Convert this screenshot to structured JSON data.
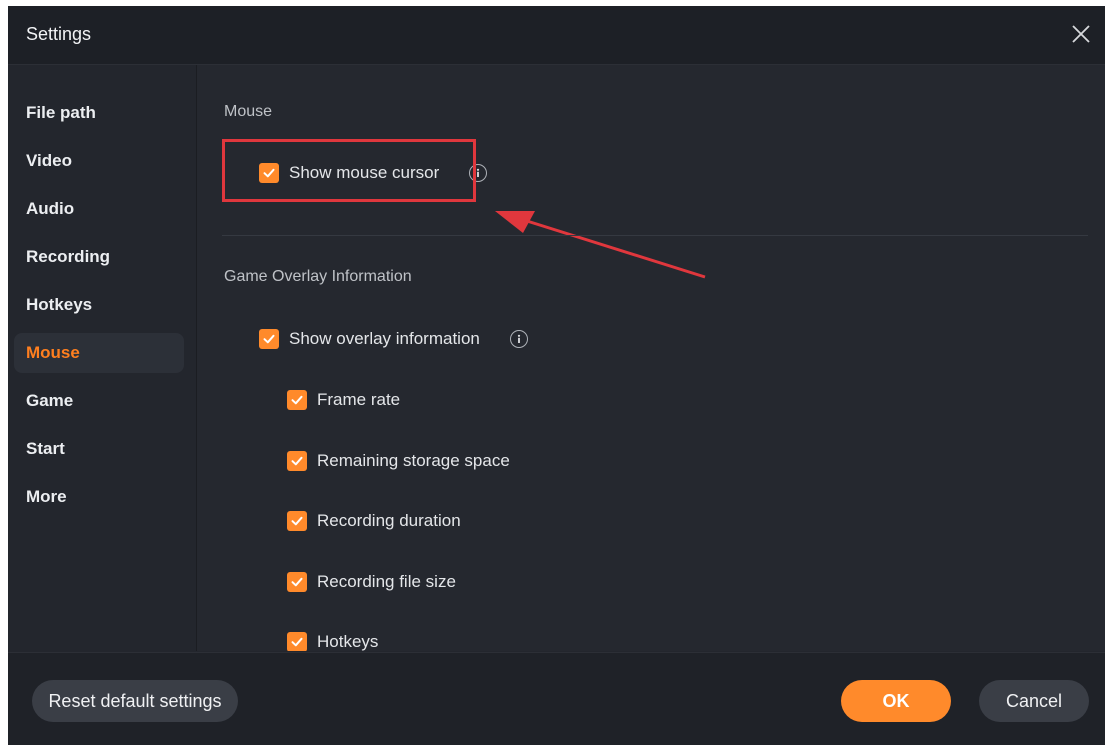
{
  "window": {
    "title": "Settings"
  },
  "sidebar": {
    "items": [
      {
        "label": "File path"
      },
      {
        "label": "Video"
      },
      {
        "label": "Audio"
      },
      {
        "label": "Recording"
      },
      {
        "label": "Hotkeys"
      },
      {
        "label": "Mouse",
        "active": true
      },
      {
        "label": "Game"
      },
      {
        "label": "Start"
      },
      {
        "label": "More"
      }
    ]
  },
  "mouse_section": {
    "title": "Mouse",
    "show_cursor": {
      "label": "Show mouse cursor",
      "checked": true
    }
  },
  "overlay_section": {
    "title": "Game Overlay Information",
    "show_overlay": {
      "label": "Show overlay information",
      "checked": true
    },
    "options": [
      {
        "label": "Frame rate",
        "checked": true
      },
      {
        "label": "Remaining storage space",
        "checked": true
      },
      {
        "label": "Recording duration",
        "checked": true
      },
      {
        "label": "Recording file size",
        "checked": true
      },
      {
        "label": "Hotkeys",
        "checked": true
      }
    ]
  },
  "footer": {
    "reset_label": "Reset default settings",
    "ok_label": "OK",
    "cancel_label": "Cancel"
  },
  "colors": {
    "accent": "#ff8a2b",
    "active_nav_text": "#ff7f1f",
    "annotation": "#e0373d",
    "background": "#23262d"
  },
  "icons": {
    "close": "close-icon",
    "info": "info-icon",
    "check": "checkmark-icon"
  }
}
